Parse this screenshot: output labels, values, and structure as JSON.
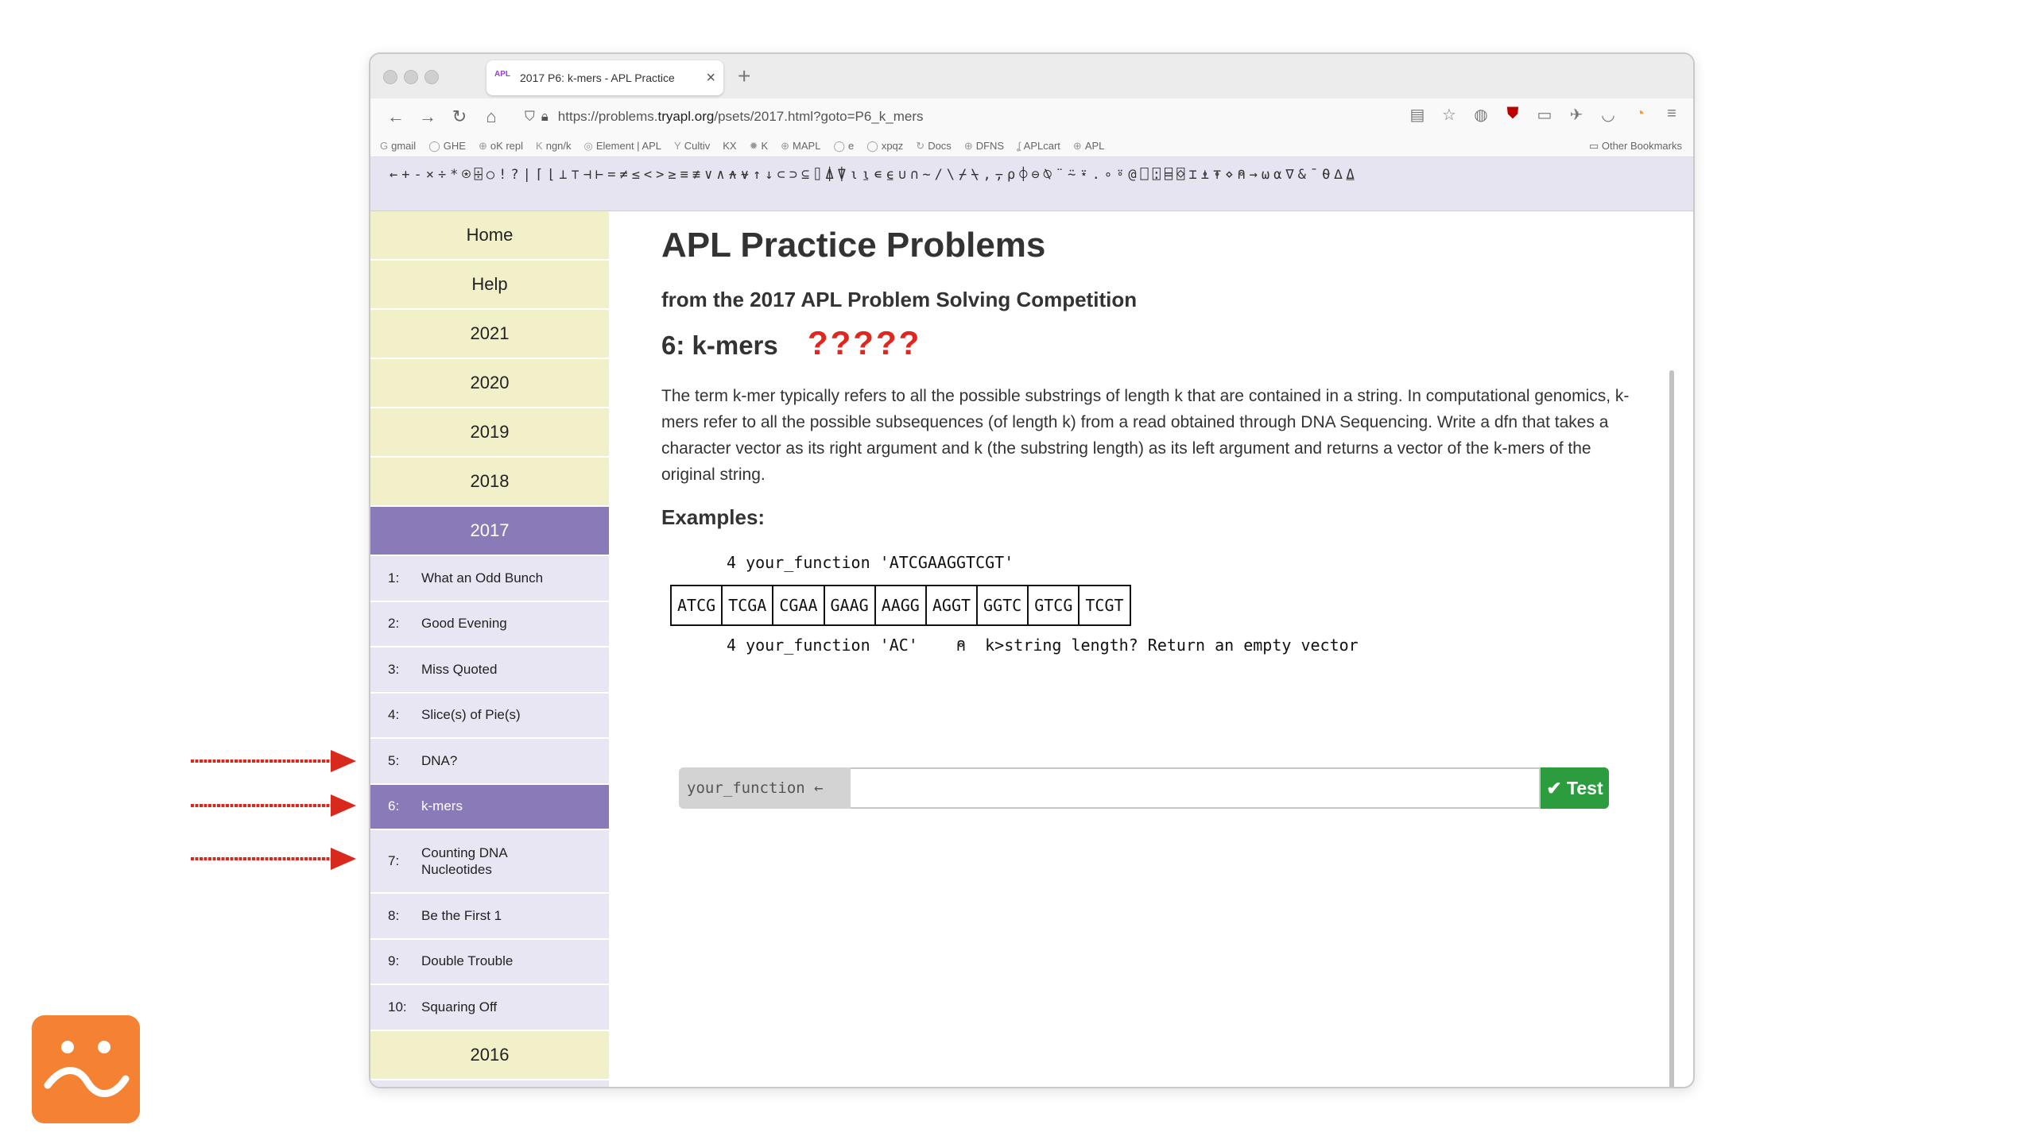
{
  "browser": {
    "tab_title": "2017 P6: k-mers - APL Practice",
    "tab_favicon": "APL",
    "new_tab_icon": "+",
    "url_prefix": "https://problems.",
    "url_domain": "tryapl.org",
    "url_path": "/psets/2017.html?goto=P6_k_mers",
    "bookmarks": [
      {
        "icon": "G",
        "label": "gmail"
      },
      {
        "icon": "◯",
        "label": "GHE"
      },
      {
        "icon": "⊕",
        "label": "oK repl"
      },
      {
        "icon": "K",
        "label": "ngn/k"
      },
      {
        "icon": "◎",
        "label": "Element | APL"
      },
      {
        "icon": "Y",
        "label": "Cultiv"
      },
      {
        "icon": "",
        "label": "KX"
      },
      {
        "icon": "✹",
        "label": "K"
      },
      {
        "icon": "⊕",
        "label": "MAPL"
      },
      {
        "icon": "◯",
        "label": "e"
      },
      {
        "icon": "◯",
        "label": "xpqz"
      },
      {
        "icon": "↻",
        "label": "Docs"
      },
      {
        "icon": "⊕",
        "label": "DFNS"
      },
      {
        "icon": "ʆ",
        "label": "APLcart"
      },
      {
        "icon": "⊕",
        "label": "APL"
      }
    ],
    "other_bookmarks": "Other Bookmarks"
  },
  "language_bar": "←+-×÷*⍟⌹○!?|⌈⌊⊥⊤⊣⊢=≠≤<>≥≡≢∨∧⍲⍱↑↓⊂⊃⊆⌷⍋⍒⍳⍸∊⍷∪∩~/\\⌿⍀,⍪⍴⌽⊖⍉¨⍨⍣.∘⍤@⎕⍠⌸⌺⌶⍎⍕⋄⍝→⍵⍺∇&¯⍬∆⍙",
  "sidebar": {
    "years_top": [
      "Home",
      "Help",
      "2021",
      "2020",
      "2019",
      "2018"
    ],
    "active_year": "2017",
    "problems": [
      {
        "num": "1:",
        "title": "What an Odd Bunch"
      },
      {
        "num": "2:",
        "title": "Good Evening"
      },
      {
        "num": "3:",
        "title": "Miss Quoted"
      },
      {
        "num": "4:",
        "title": "Slice(s) of Pie(s)"
      },
      {
        "num": "5:",
        "title": "DNA?"
      },
      {
        "num": "6:",
        "title": "k-mers"
      },
      {
        "num": "7:",
        "title": "Counting DNA Nucleotides"
      },
      {
        "num": "8:",
        "title": "Be the First 1"
      },
      {
        "num": "9:",
        "title": "Double Trouble"
      },
      {
        "num": "10:",
        "title": "Squaring Off"
      }
    ],
    "years_bottom": [
      "2016"
    ]
  },
  "main": {
    "title": "APL Practice Problems",
    "subtitle": "from the 2017 APL Problem Solving Competition",
    "problem_title": "6: k-mers",
    "annotation": "?????",
    "description": "The term k-mer typically refers to all the possible substrings of length k that are contained in a string. In computational genomics, k-mers refer to all the possible subsequences (of length k) from a read obtained through DNA Sequencing. Write a dfn that takes a character vector as its right argument and k (the substring length) as its left argument and returns a vector of the k-mers of the original string.",
    "examples_heading": "Examples:",
    "example1_code": "4 your_function 'ATCGAAGGTCGT'",
    "example1_output": [
      "ATCG",
      "TCGA",
      "CGAA",
      "GAAG",
      "AAGG",
      "AGGT",
      "GGTC",
      "GTCG",
      "TCGT"
    ],
    "example2_code": "4 your_function 'AC'    ⍝  k>string length? Return an empty vector",
    "input_label": "your_function ←",
    "input_value": "",
    "test_button": "✔ Test"
  },
  "colors": {
    "accent_purple": "#8b7ab8",
    "sidebar_year_bg": "#f2f0c8",
    "test_green": "#2b9d3e",
    "annotation_red": "#e0261e",
    "logo_orange": "#f58232"
  }
}
